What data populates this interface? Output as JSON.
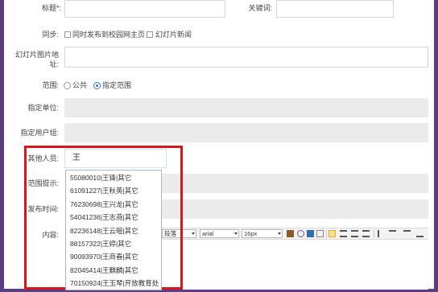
{
  "form": {
    "title_label": "标题*:",
    "keyword_label": "关键词:",
    "sync_label": "同步:",
    "sync_option_homepage": "同时发布到校园网主页",
    "sync_option_slides": "幻灯片新闻",
    "slide_url_label_line1": "幻灯片图片地",
    "slide_url_label_line2": "址:",
    "scope_label": "范围:",
    "scope_public": "公共",
    "scope_specified": "指定范围",
    "unit_label": "指定单位:",
    "user_group_label": "指定用户组:",
    "other_people_label": "其他人员:",
    "other_people_value": "王",
    "scope_hint_label": "范围提示:",
    "publish_time_label": "发布时间:",
    "content_label": "内容:"
  },
  "suggestions": [
    "55080010|王锋|其它",
    "61091227|王秋英|其它",
    "76230698|王兴龙|其它",
    "54041236|王志燕|其它",
    "82236148|王云暄|其它",
    "88157322|王婷|其它",
    "90093970|王商春|其它",
    "82045414|王麒麟|其它",
    "70150924|王玉琴|开放教育处"
  ],
  "editor_toolbar": {
    "paragraph": "段落",
    "font": "arial",
    "size": "16px"
  },
  "colors": {
    "highlight_border": "#d9161d",
    "accent": "#3b7dd8",
    "window_frame": "#5a3d82"
  }
}
